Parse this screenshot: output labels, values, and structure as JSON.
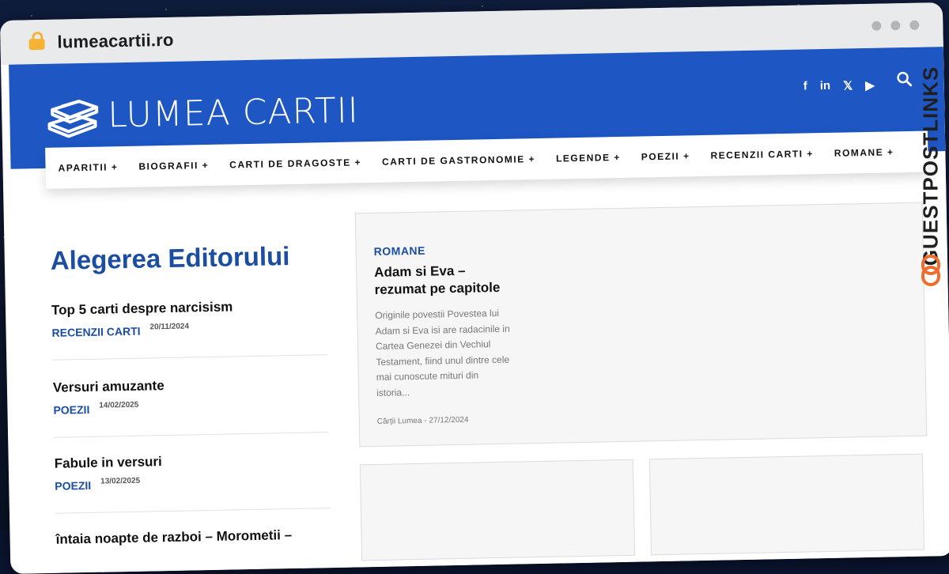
{
  "browser": {
    "url": "lumeacartii.ro",
    "icons": {
      "lock": "lock-icon",
      "window_controls": "three-dot-controls"
    }
  },
  "colors": {
    "header_blue": "#1e57c4",
    "accent_blue": "#1b4da0",
    "lock_yellow": "#f5b335",
    "brand_orange": "#f06c2c"
  },
  "header": {
    "logo_text": "LUMEA CARTII",
    "logo_icon": "books-stack-icon",
    "social": [
      {
        "name": "facebook-icon",
        "glyph": "f"
      },
      {
        "name": "linkedin-icon",
        "glyph": "in"
      },
      {
        "name": "x-icon",
        "glyph": "𝕏"
      },
      {
        "name": "youtube-icon",
        "glyph": "▶"
      }
    ],
    "search_icon": "search-icon"
  },
  "nav": {
    "items": [
      {
        "label": "APARITII +"
      },
      {
        "label": "BIOGRAFII +"
      },
      {
        "label": "CARTI DE DRAGOSTE +"
      },
      {
        "label": "CARTI DE GASTRONOMIE +"
      },
      {
        "label": "LEGENDE +"
      },
      {
        "label": "POEZII +"
      },
      {
        "label": "RECENZII CARTI +"
      },
      {
        "label": "ROMANE +"
      }
    ]
  },
  "editor_picks": {
    "title": "Alegerea Editorului",
    "items": [
      {
        "title": "Top 5 carti despre narcisism",
        "category": "RECENZII CARTI",
        "date": "20/11/2024"
      },
      {
        "title": "Versuri amuzante",
        "category": "POEZII",
        "date": "14/02/2025"
      },
      {
        "title": "Fabule in versuri",
        "category": "POEZII",
        "date": "13/02/2025"
      },
      {
        "title": "întaia noapte de razboi – Morometii –",
        "category": "",
        "date": ""
      }
    ]
  },
  "featured": {
    "category": "ROMANE",
    "title": "Adam si Eva – rezumat pe capitole",
    "excerpt": "Originile povestii Povestea lui Adam si Eva isi are radacinile in Cartea Genezei din Vechiul Testament, fiind unul dintre cele mai cunoscute mituri din istoria...",
    "author": "Cărții Lumea",
    "separator": "-",
    "date": "27/12/2024"
  },
  "side_brand": {
    "text": "GUESTPOSTLINKS",
    "icon": "chain-link-icon"
  }
}
